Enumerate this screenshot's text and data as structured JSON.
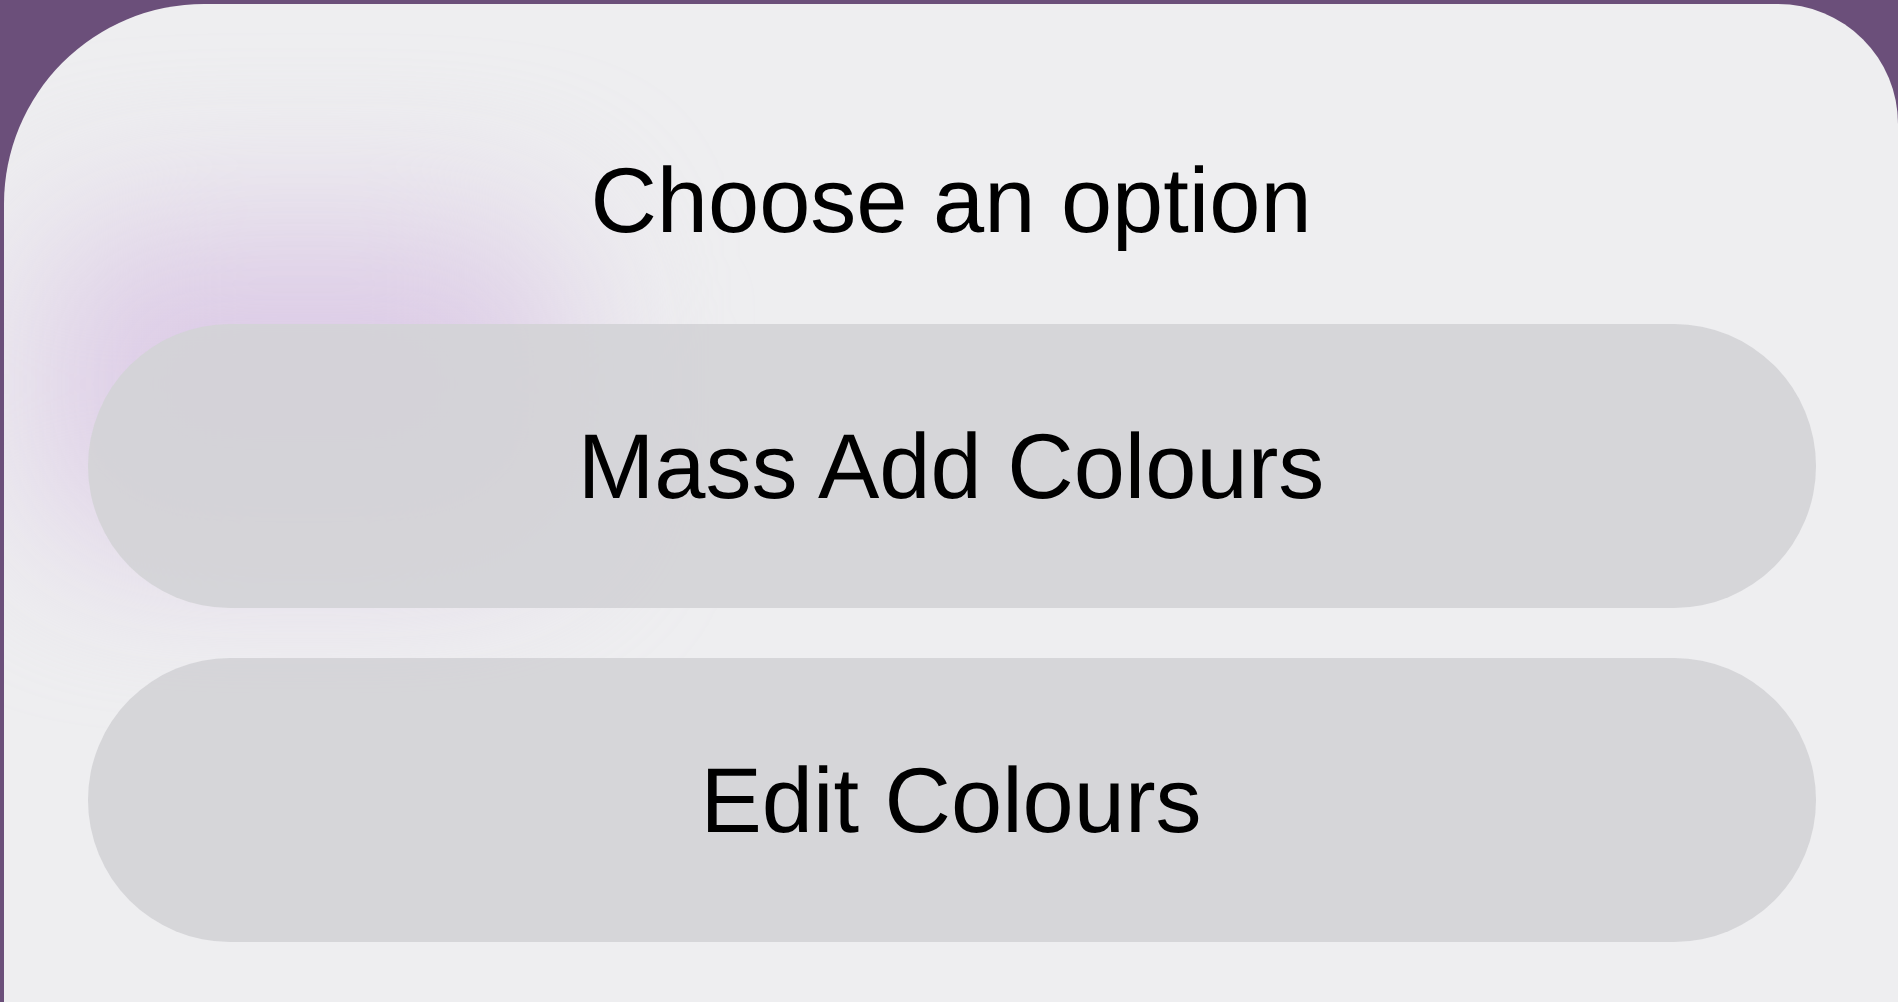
{
  "sheet": {
    "title": "Choose an option"
  },
  "buttons": [
    {
      "label": "Mass Add Colours"
    },
    {
      "label": "Edit Colours"
    }
  ]
}
